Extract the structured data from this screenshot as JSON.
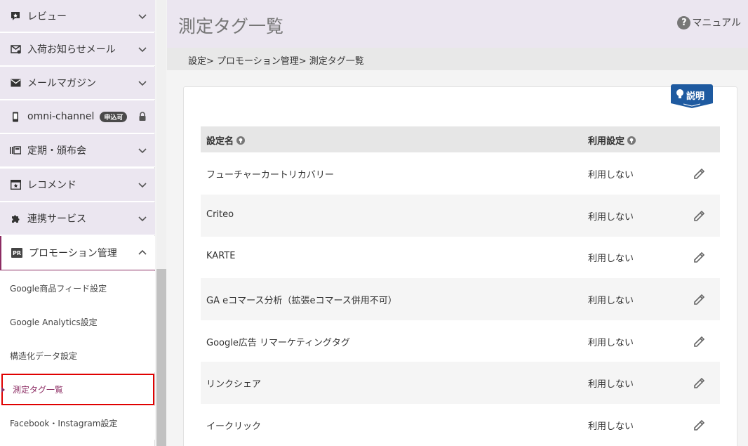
{
  "sidebar": {
    "items": [
      {
        "label": "レビュー",
        "icon": "review-star-icon"
      },
      {
        "label": "入荷お知らせメール",
        "icon": "mail-arrival-icon"
      },
      {
        "label": "メールマガジン",
        "icon": "envelope-icon"
      },
      {
        "label": "omni-channel",
        "badge": "申込可",
        "icon": "phone-icon"
      },
      {
        "label": "定期・頒布会",
        "icon": "subscription-icon"
      },
      {
        "label": "レコメンド",
        "icon": "recommend-icon"
      },
      {
        "label": "連携サービス",
        "icon": "puzzle-icon"
      },
      {
        "label": "プロモーション管理",
        "icon": "pr-icon",
        "pr_text": "PR"
      }
    ],
    "subitems": [
      {
        "label": "Google商品フィード設定"
      },
      {
        "label": "Google Analytics設定"
      },
      {
        "label": "構造化データ設定"
      },
      {
        "label": "測定タグ一覧"
      },
      {
        "label": "Facebook・Instagram設定"
      }
    ]
  },
  "header": {
    "title": "測定タグ一覧",
    "manual_label": "マニュアル",
    "manual_icon": "?"
  },
  "breadcrumb": "設定> プロモーション管理> 測定タグ一覧",
  "help_tab": {
    "label": "説明"
  },
  "table": {
    "col_name": "設定名",
    "col_use": "利用設定",
    "rows": [
      {
        "name": "フューチャーカートリカバリー",
        "use": "利用しない"
      },
      {
        "name": "Criteo",
        "use": "利用しない"
      },
      {
        "name": "KARTE",
        "use": "利用しない"
      },
      {
        "name": "GA eコマース分析（拡張eコマース併用不可）",
        "use": "利用しない"
      },
      {
        "name": "Google広告 リマーケティングタグ",
        "use": "利用しない"
      },
      {
        "name": "リンクシェア",
        "use": "利用しない"
      },
      {
        "name": "イークリック",
        "use": "利用しない"
      }
    ]
  },
  "colors": {
    "accent": "#8c2c63",
    "nav_bg": "#ebe6f0",
    "help_blue": "#1e5aa0",
    "highlight_red": "#e00000"
  }
}
